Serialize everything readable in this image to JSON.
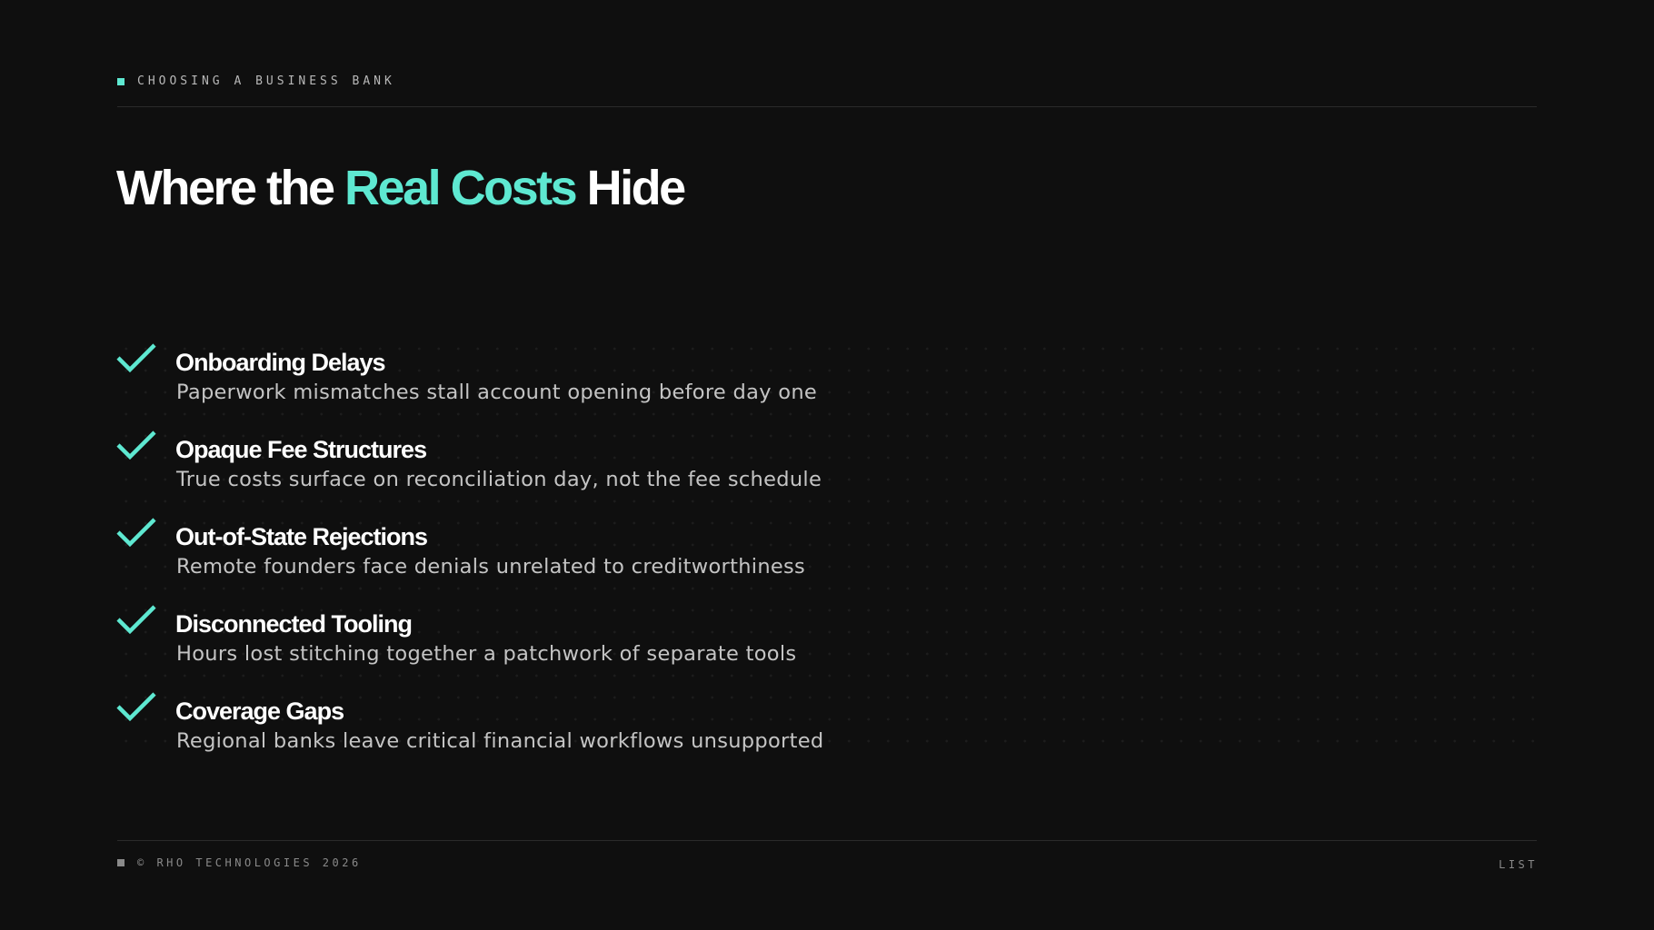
{
  "header": {
    "kicker": "CHOOSING A BUSINESS BANK"
  },
  "title": {
    "prefix": "Where the ",
    "highlight": "Real Costs",
    "suffix": " Hide"
  },
  "items": [
    {
      "title": "Onboarding Delays",
      "description": "Paperwork mismatches stall account opening before day one"
    },
    {
      "title": "Opaque Fee Structures",
      "description": "True costs surface on reconciliation day, not the fee schedule"
    },
    {
      "title": "Out-of-State Rejections",
      "description": "Remote founders face denials unrelated to creditworthiness"
    },
    {
      "title": "Disconnected Tooling",
      "description": "Hours lost stitching together a patchwork of separate tools"
    },
    {
      "title": "Coverage Gaps",
      "description": "Regional banks leave critical financial workflows unsupported"
    }
  ],
  "footer": {
    "copyright": "© RHO TECHNOLOGIES 2026",
    "layout_label": "LIST"
  },
  "colors": {
    "background": "#0f0f0f",
    "accent": "#5ee8d1",
    "text": "#ffffff",
    "muted_text": "#c4c4c4"
  },
  "icons": {
    "list_marker": "check-icon",
    "header_marker": "square-icon"
  }
}
